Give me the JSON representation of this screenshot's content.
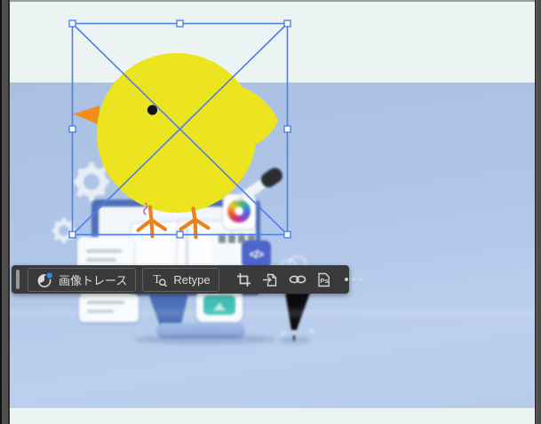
{
  "colors": {
    "canvas-bg": "#ebf3f3",
    "photo-blue-top": "#a9c0e3",
    "photo-blue-bottom": "#bccfee",
    "selection-blue": "#4c80e8",
    "bar-bg": "#3a3a3a",
    "bar-border": "#616161",
    "bar-text": "#dedede",
    "bar-icon": "#d2d2d2",
    "trace-dot-blue": "#2f8ceb",
    "bird-yellow": "#ece41f",
    "beak-orange": "#ef8d1d",
    "turbine-orange": "#e8831d",
    "squiggle-pink": "#d95fa4",
    "monitor-blue": "#4e6fb7",
    "badge-blue": "#4d66cc",
    "teal": "#3fbfb4"
  },
  "task_bar": {
    "buttons": [
      {
        "id": "image-trace",
        "label": "画像トレース",
        "icon": "image-trace-icon"
      },
      {
        "id": "retype",
        "label": "Retype",
        "icon": "retype-icon",
        "icon_letter": "T"
      }
    ],
    "icon_buttons": [
      {
        "id": "crop-image",
        "icon": "crop-icon"
      },
      {
        "id": "embed-image",
        "icon": "embed-icon"
      },
      {
        "id": "link-options",
        "icon": "link-icon"
      },
      {
        "id": "edit-in-photoshop",
        "icon": "photoshop-icon",
        "label": "Ps"
      },
      {
        "id": "more-options",
        "icon": "ellipsis-icon"
      }
    ]
  },
  "selection": {
    "type": "placed-image",
    "handle_count": 8,
    "has_diagonal_cross": true
  },
  "photo": {
    "code_badge_text": "</>"
  }
}
